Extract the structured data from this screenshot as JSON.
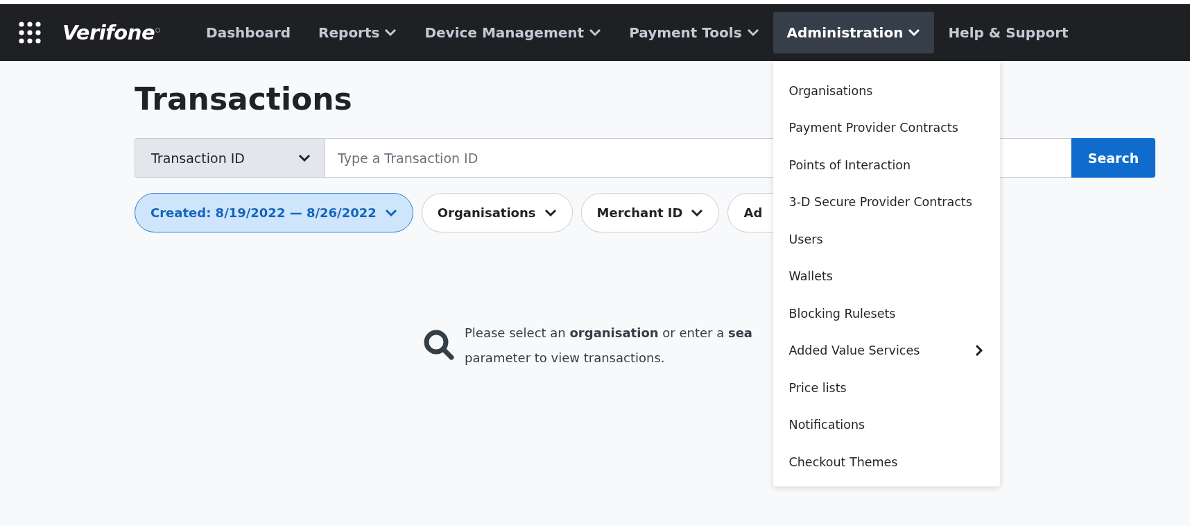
{
  "nav": {
    "logo": "Verifone",
    "items": [
      {
        "label": "Dashboard",
        "dropdown": false,
        "selected": false
      },
      {
        "label": "Reports",
        "dropdown": true,
        "selected": false
      },
      {
        "label": "Device Management",
        "dropdown": true,
        "selected": false
      },
      {
        "label": "Payment Tools",
        "dropdown": true,
        "selected": false
      },
      {
        "label": "Administration",
        "dropdown": true,
        "selected": true
      },
      {
        "label": "Help & Support",
        "dropdown": false,
        "selected": false
      }
    ]
  },
  "menu": {
    "items": [
      {
        "label": "Organisations",
        "submenu": false
      },
      {
        "label": "Payment Provider Contracts",
        "submenu": false
      },
      {
        "label": "Points of Interaction",
        "submenu": false
      },
      {
        "label": "3-D Secure Provider Contracts",
        "submenu": false
      },
      {
        "label": "Users",
        "submenu": false
      },
      {
        "label": "Wallets",
        "submenu": false
      },
      {
        "label": "Blocking Rulesets",
        "submenu": false
      },
      {
        "label": "Added Value Services",
        "submenu": true
      },
      {
        "label": "Price lists",
        "submenu": false
      },
      {
        "label": "Notifications",
        "submenu": false
      },
      {
        "label": "Checkout Themes",
        "submenu": false
      }
    ]
  },
  "page": {
    "title": "Transactions",
    "search": {
      "type": "Transaction ID",
      "placeholder": "Type a Transaction ID",
      "button": "Search"
    },
    "filters": [
      {
        "label": "Created: 8/19/2022 — 8/26/2022",
        "selected": true,
        "cut": false
      },
      {
        "label": "Organisations",
        "selected": false,
        "cut": false
      },
      {
        "label": "Merchant ID",
        "selected": false,
        "cut": false
      },
      {
        "label": "Ad",
        "selected": false,
        "cut": true
      }
    ],
    "empty": {
      "lines": [
        "Please select an **organisation** or enter a **sea**",
        "parameter to view transactions."
      ]
    }
  }
}
